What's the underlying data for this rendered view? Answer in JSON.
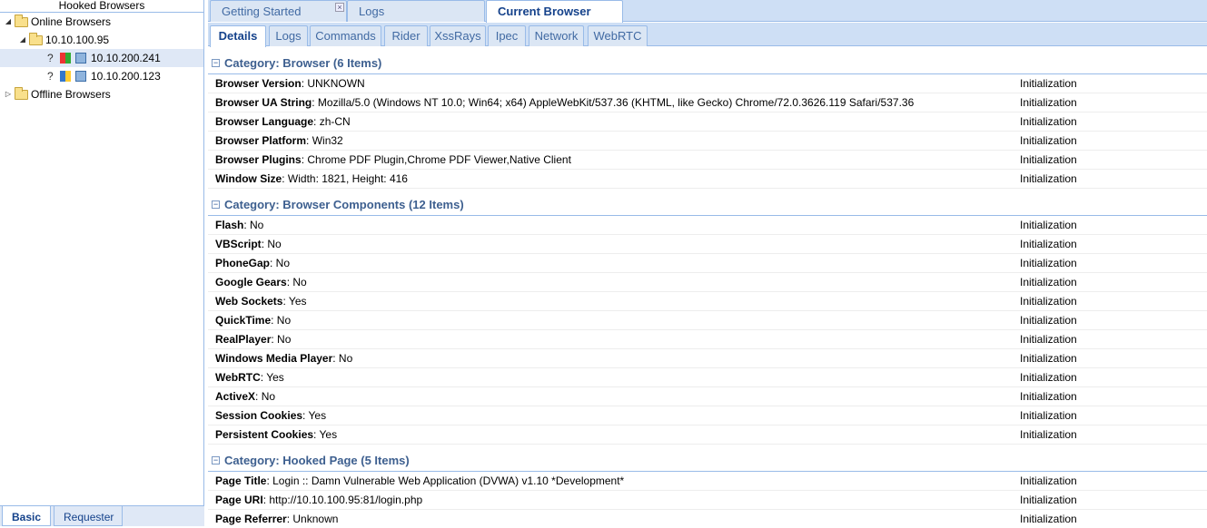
{
  "left": {
    "header": "Hooked Browsers",
    "online": "Online Browsers",
    "ip_group": "10.10.100.95",
    "hosts": [
      {
        "unknown": "?",
        "ip": "10.10.200.241"
      },
      {
        "unknown": "?",
        "ip": "10.10.200.123"
      }
    ],
    "offline": "Offline Browsers",
    "tabs": [
      "Basic",
      "Requester"
    ]
  },
  "top_tabs": [
    "Getting Started",
    "Logs",
    "Current Browser"
  ],
  "close_glyph": "×",
  "sub_tabs": [
    "Details",
    "Logs",
    "Commands",
    "Rider",
    "XssRays",
    "Ipec",
    "Network",
    "WebRTC"
  ],
  "toggle_glyph": "−",
  "categories": [
    {
      "title": "Category: Browser (6 Items)",
      "rows": [
        {
          "key": "Browser Version",
          "value": ": UNKNOWN",
          "status": "Initialization"
        },
        {
          "key": "Browser UA String",
          "value": ": Mozilla/5.0 (Windows NT 10.0; Win64; x64) AppleWebKit/537.36 (KHTML, like Gecko) Chrome/72.0.3626.119 Safari/537.36",
          "status": "Initialization"
        },
        {
          "key": "Browser Language",
          "value": ": zh-CN",
          "status": "Initialization"
        },
        {
          "key": "Browser Platform",
          "value": ": Win32",
          "status": "Initialization"
        },
        {
          "key": "Browser Plugins",
          "value": ": Chrome PDF Plugin,Chrome PDF Viewer,Native Client",
          "status": "Initialization"
        },
        {
          "key": "Window Size",
          "value": ": Width: 1821, Height: 416",
          "status": "Initialization"
        }
      ]
    },
    {
      "title": "Category: Browser Components (12 Items)",
      "rows": [
        {
          "key": "Flash",
          "value": ": No",
          "status": "Initialization"
        },
        {
          "key": "VBScript",
          "value": ": No",
          "status": "Initialization"
        },
        {
          "key": "PhoneGap",
          "value": ": No",
          "status": "Initialization"
        },
        {
          "key": "Google Gears",
          "value": ": No",
          "status": "Initialization"
        },
        {
          "key": "Web Sockets",
          "value": ": Yes",
          "status": "Initialization"
        },
        {
          "key": "QuickTime",
          "value": ": No",
          "status": "Initialization"
        },
        {
          "key": "RealPlayer",
          "value": ": No",
          "status": "Initialization"
        },
        {
          "key": "Windows Media Player",
          "value": ": No",
          "status": "Initialization"
        },
        {
          "key": "WebRTC",
          "value": ": Yes",
          "status": "Initialization"
        },
        {
          "key": "ActiveX",
          "value": ": No",
          "status": "Initialization"
        },
        {
          "key": "Session Cookies",
          "value": ": Yes",
          "status": "Initialization"
        },
        {
          "key": "Persistent Cookies",
          "value": ": Yes",
          "status": "Initialization"
        }
      ]
    },
    {
      "title": "Category: Hooked Page (5 Items)",
      "rows": [
        {
          "key": "Page Title",
          "value": ": Login :: Damn Vulnerable Web Application (DVWA) v1.10 *Development*",
          "status": "Initialization"
        },
        {
          "key": "Page URI",
          "value": ": http://10.10.100.95:81/login.php",
          "status": "Initialization"
        },
        {
          "key": "Page Referrer",
          "value": ": Unknown",
          "status": "Initialization"
        }
      ]
    }
  ]
}
